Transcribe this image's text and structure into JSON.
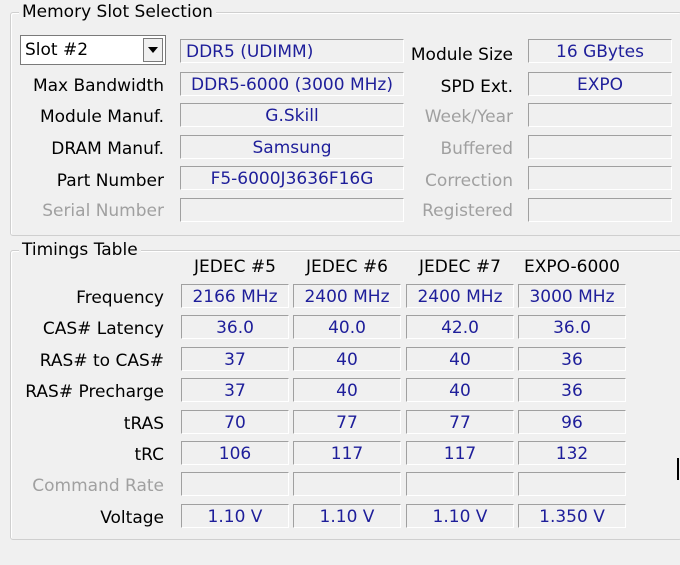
{
  "memory_slot": {
    "title": "Memory Slot Selection",
    "slot_select": {
      "value": "Slot #2"
    },
    "module_type": "DDR5 (UDIMM)",
    "labels": {
      "max_bandwidth": "Max Bandwidth",
      "module_manuf": "Module Manuf.",
      "dram_manuf": "DRAM Manuf.",
      "part_number": "Part Number",
      "serial_number": "Serial Number",
      "module_size": "Module Size",
      "spd_ext": "SPD Ext.",
      "week_year": "Week/Year",
      "buffered": "Buffered",
      "correction": "Correction",
      "registered": "Registered"
    },
    "values": {
      "max_bandwidth": "DDR5-6000 (3000 MHz)",
      "module_manuf": "G.Skill",
      "dram_manuf": "Samsung",
      "part_number": "F5-6000J3636F16G",
      "serial_number": "",
      "module_size": "16 GBytes",
      "spd_ext": "EXPO",
      "week_year": "",
      "buffered": "",
      "correction": "",
      "registered": ""
    }
  },
  "timings": {
    "title": "Timings Table",
    "columns": [
      "JEDEC #5",
      "JEDEC #6",
      "JEDEC #7",
      "EXPO-6000"
    ],
    "rows": [
      {
        "label": "Frequency",
        "values": [
          "2166 MHz",
          "2400 MHz",
          "2400 MHz",
          "3000 MHz"
        ]
      },
      {
        "label": "CAS# Latency",
        "values": [
          "36.0",
          "40.0",
          "42.0",
          "36.0"
        ]
      },
      {
        "label": "RAS# to CAS#",
        "values": [
          "37",
          "40",
          "40",
          "36"
        ]
      },
      {
        "label": "RAS# Precharge",
        "values": [
          "37",
          "40",
          "40",
          "36"
        ]
      },
      {
        "label": "tRAS",
        "values": [
          "70",
          "77",
          "77",
          "96"
        ]
      },
      {
        "label": "tRC",
        "values": [
          "106",
          "117",
          "117",
          "132"
        ]
      },
      {
        "label": "Command Rate",
        "values": [
          "",
          "",
          "",
          ""
        ]
      },
      {
        "label": "Voltage",
        "values": [
          "1.10 V",
          "1.10 V",
          "1.10 V",
          "1.350 V"
        ]
      }
    ]
  }
}
